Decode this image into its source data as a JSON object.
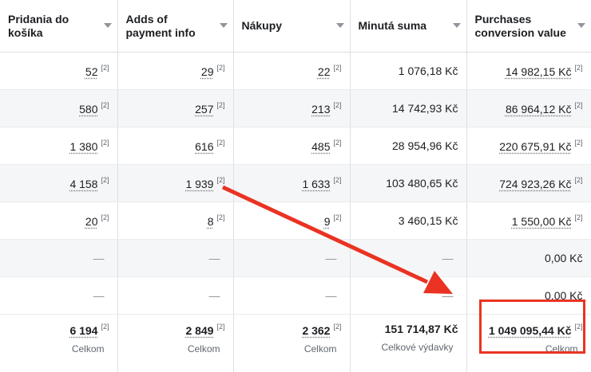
{
  "headers": [
    {
      "label": "Pridania do košíka"
    },
    {
      "label": "Adds of payment info"
    },
    {
      "label": "Nákupy"
    },
    {
      "label": "Minutá suma"
    },
    {
      "label": "Purchases conversion value"
    }
  ],
  "footnote": "[2]",
  "rows": [
    {
      "cart": "52",
      "payment": "29",
      "purchases": "22",
      "spent": "1 076,18 Kč",
      "value": "14 982,15 Kč"
    },
    {
      "cart": "580",
      "payment": "257",
      "purchases": "213",
      "spent": "14 742,93 Kč",
      "value": "86 964,12 Kč"
    },
    {
      "cart": "1 380",
      "payment": "616",
      "purchases": "485",
      "spent": "28 954,96 Kč",
      "value": "220 675,91 Kč"
    },
    {
      "cart": "4 158",
      "payment": "1 939",
      "purchases": "1 633",
      "spent": "103 480,65 Kč",
      "value": "724 923,26 Kč"
    },
    {
      "cart": "20",
      "payment": "8",
      "purchases": "9",
      "spent": "3 460,15 Kč",
      "value": "1 550,00 Kč"
    },
    {
      "cart": "—",
      "payment": "—",
      "purchases": "—",
      "spent": "—",
      "value": "0,00 Kč"
    },
    {
      "cart": "—",
      "payment": "—",
      "purchases": "—",
      "spent": "—",
      "value": "0,00 Kč"
    }
  ],
  "totals": {
    "cart": {
      "value": "6 194",
      "label": "Celkom"
    },
    "payment": {
      "value": "2 849",
      "label": "Celkom"
    },
    "purchases": {
      "value": "2 362",
      "label": "Celkom"
    },
    "spent": {
      "value": "151 714,87 Kč",
      "label": "Celkové výdavky"
    },
    "value": {
      "value": "1 049 095,44 Kč",
      "label": "Celkom"
    }
  },
  "annotation_color": "#ea3323"
}
